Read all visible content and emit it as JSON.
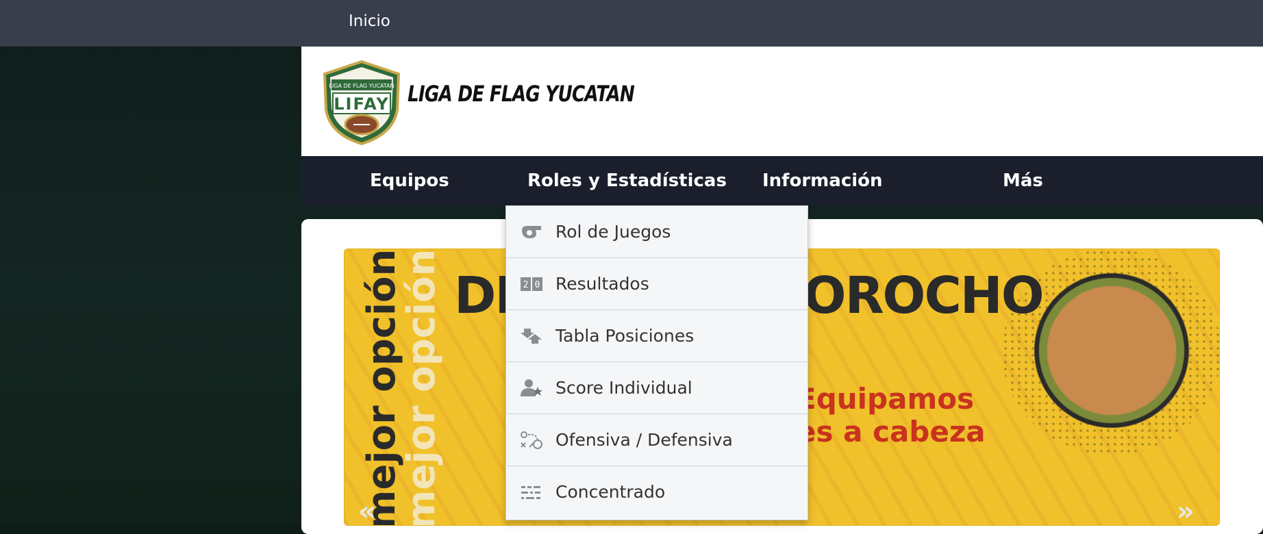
{
  "topbar": {
    "home_label": "Inicio"
  },
  "header": {
    "logo_arc_text": "LIGA DE FLAG YUCATAN",
    "logo_letters": "LIFAY",
    "title": "LIGA DE FLAG YUCATAN"
  },
  "nav": {
    "items": [
      {
        "label": "Equipos"
      },
      {
        "label": "Roles y Estadísticas"
      },
      {
        "label": "Información"
      },
      {
        "label": "Más"
      }
    ]
  },
  "dropdown": {
    "items": [
      {
        "label": "Rol de Juegos",
        "icon": "whistle-icon"
      },
      {
        "label": "Resultados",
        "icon": "scoreboard-icon"
      },
      {
        "label": "Tabla Posiciones",
        "icon": "ranking-arrows-icon"
      },
      {
        "label": "Score Individual",
        "icon": "player-star-icon"
      },
      {
        "label": "Ofensiva / Defensiva",
        "icon": "playbook-icon"
      },
      {
        "label": "Concentrado",
        "icon": "summary-list-icon"
      }
    ]
  },
  "banner": {
    "vertical_text": "mejor opción",
    "headline": "DE TOCHO MOROCHO",
    "red_text_line1": "Equipamos",
    "red_text_line2": "es a cabeza",
    "prev_arrow": "«",
    "next_arrow": "»"
  },
  "colors": {
    "topbar": "#383e4c",
    "navbar": "#1b1e2b",
    "banner_yellow": "#f0c12a",
    "logo_green": "#2f6b3a",
    "logo_gold": "#c9a64a"
  }
}
